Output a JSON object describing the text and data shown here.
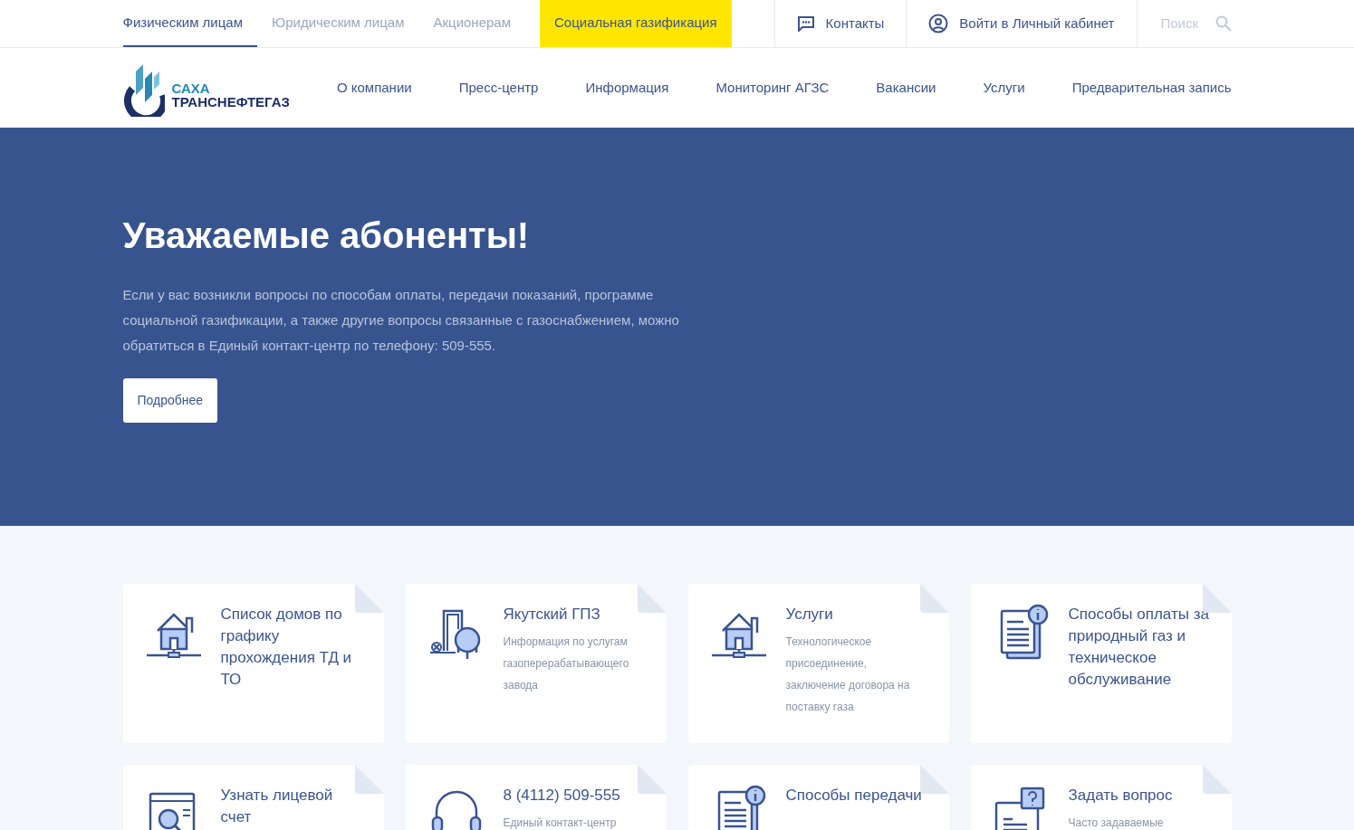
{
  "top_tabs": [
    {
      "label": "Физическим лицам",
      "selected": true,
      "highlighted": false
    },
    {
      "label": "Юридическим лицам",
      "selected": false,
      "highlighted": false
    },
    {
      "label": "Акционерам",
      "selected": false,
      "highlighted": false
    },
    {
      "label": "Социальная газификация",
      "selected": false,
      "highlighted": true
    }
  ],
  "contacts_link": "Контакты",
  "login_link": "Войти в Личный кабинет",
  "search": {
    "placeholder": "Поиск"
  },
  "logo": {
    "line_1": "САХА",
    "line_2": "ТРАНСНЕФТЕГАЗ"
  },
  "main_menu": [
    "О компании",
    "Пресс-центр",
    "Информация",
    "Мониторинг АГЗС",
    "Вакансии",
    "Услуги",
    "Предварительная запись"
  ],
  "hero": {
    "title": "Уважаемые абоненты!",
    "text": "Если у вас возникли вопросы по способам оплаты, передачи показаний, программе социальной газификации, а также другие вопросы связанные с газоснабжением, можно обратиться в Единый контакт-центр по телефону: 509-555.",
    "button": "Подробнее"
  },
  "cards": [
    {
      "title": "Список домов по графику прохождения ТД и ТО"
    },
    {
      "title": "Якутский ГПЗ",
      "text": "Информация по услугам газоперерабатывающего завода"
    },
    {
      "title": "Услуги",
      "text": "Технологическое присоединение, заключение договора на поставку газа"
    },
    {
      "title": "Способы оплаты за природный газ и техническое обслуживание"
    },
    {
      "title": "Узнать лицевой счет"
    },
    {
      "title": "8 (4112) 509-555",
      "text": "Единый контакт-центр"
    },
    {
      "title": "Способы передачи"
    },
    {
      "title": "Задать вопрос",
      "text": "Часто задаваемые"
    }
  ]
}
